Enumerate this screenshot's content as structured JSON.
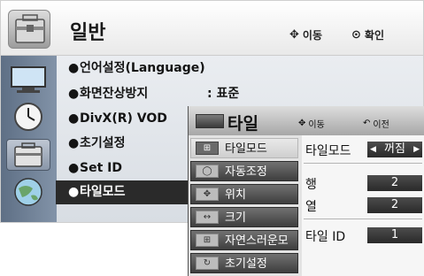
{
  "header": {
    "title": "일반",
    "move_hint": "이동",
    "ok_hint": "확인"
  },
  "menu": {
    "items": [
      {
        "label": "언어설정(Language)",
        "value": ""
      },
      {
        "label": "화면잔상방지",
        "value": ": 표준"
      },
      {
        "label": "DivX(R) VOD",
        "value": ""
      },
      {
        "label": "초기설정",
        "value": ""
      },
      {
        "label": "Set ID",
        "value": ""
      },
      {
        "label": "타일모드",
        "value": ""
      }
    ],
    "bullet": "●"
  },
  "sidebar_icons": [
    "monitor-icon",
    "clock-icon",
    "toolbox-icon",
    "globe-icon"
  ],
  "popup": {
    "title": "타일",
    "move_hint": "이동",
    "back_hint": "이전",
    "items": [
      {
        "label": "타일모드",
        "icon": "⊞"
      },
      {
        "label": "자동조정",
        "icon": "◯"
      },
      {
        "label": "위치",
        "icon": "✥"
      },
      {
        "label": "크기",
        "icon": "↔"
      },
      {
        "label": "자연스러운모드",
        "icon": "⊞"
      },
      {
        "label": "초기설정",
        "icon": "↻"
      }
    ],
    "settings": {
      "tile_mode": {
        "label": "타일모드",
        "value": "꺼짐",
        "left_arrow": "◀",
        "right_arrow": "▶"
      },
      "row": {
        "label": "행",
        "value": "2"
      },
      "col": {
        "label": "열",
        "value": "2"
      },
      "tile_id": {
        "label": "타일 ID",
        "value": "1"
      }
    }
  }
}
